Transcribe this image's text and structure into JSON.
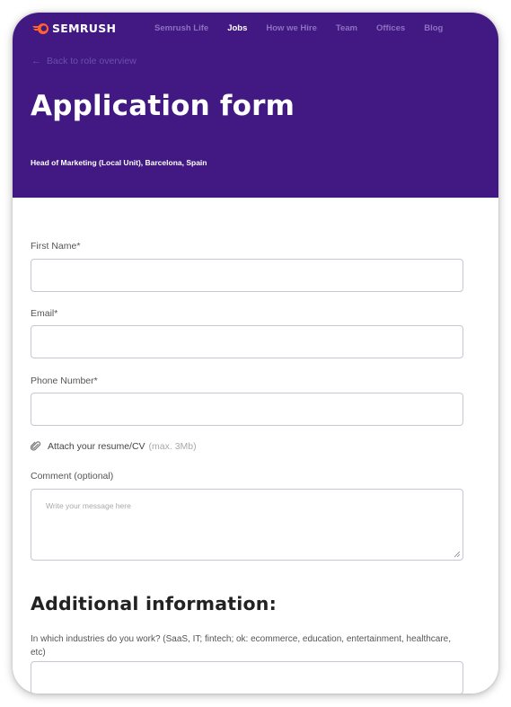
{
  "brand": {
    "name": "SEMRUSH",
    "logo_color": "#ff642d",
    "hero_color": "#421983"
  },
  "nav": {
    "items": [
      {
        "label": "Semrush Life",
        "active": false
      },
      {
        "label": "Jobs",
        "active": true
      },
      {
        "label": "How we Hire",
        "active": false
      },
      {
        "label": "Team",
        "active": false
      },
      {
        "label": "Offices",
        "active": false
      },
      {
        "label": "Blog",
        "active": false
      }
    ]
  },
  "hero": {
    "back_link": "Back to role overview",
    "back_icon": "arrow-left-icon",
    "title": "Application form",
    "subtitle": "Head of Marketing (Local Unit), Barcelona, Spain"
  },
  "form": {
    "first_name": {
      "label": "First Name*",
      "value": "",
      "placeholder": ""
    },
    "email": {
      "label": "Email*",
      "value": "",
      "placeholder": ""
    },
    "phone": {
      "label": "Phone Number*",
      "value": "",
      "placeholder": ""
    },
    "attach": {
      "icon": "paperclip-icon",
      "label": "Attach your resume/CV",
      "hint": "(max. 3Mb)"
    },
    "comment": {
      "label": "Comment (optional)",
      "value": "",
      "placeholder": "Write your message here"
    }
  },
  "additional": {
    "heading": "Additional information:",
    "industries": {
      "label": "In which industries do you work? (SaaS, IT; fintech; ok: ecommerce, education, entertainment, healthcare, etc)",
      "value": ""
    }
  }
}
